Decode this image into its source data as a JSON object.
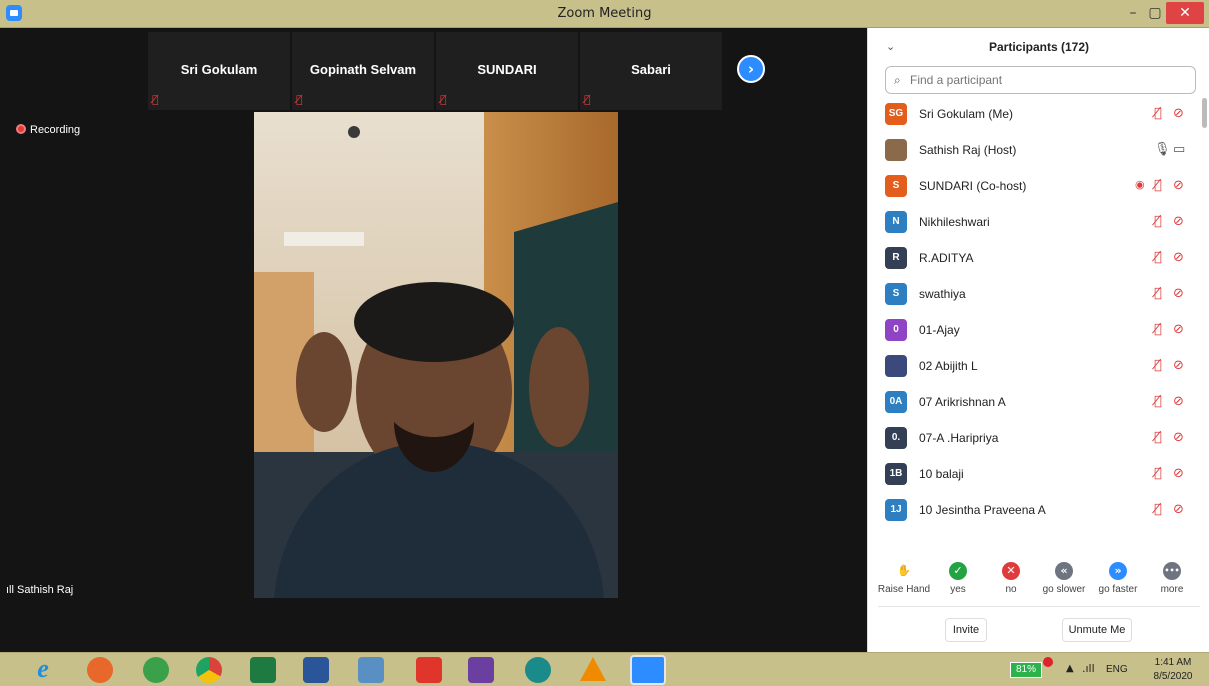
{
  "window": {
    "title": "Zoom Meeting",
    "min_label": "–",
    "max_label": "▢",
    "close_label": "✕"
  },
  "video_strip": {
    "thumbs": [
      {
        "name": "Sri Gokulam"
      },
      {
        "name": "Gopinath Selvam"
      },
      {
        "name": "SUNDARI"
      },
      {
        "name": "Sabari"
      }
    ],
    "next_icon": "›"
  },
  "recording": {
    "label": "Recording"
  },
  "active_speaker": {
    "label": "Sathish Raj"
  },
  "participants": {
    "title": "Participants (172)",
    "collapse_icon": "chevron-down-icon",
    "search_placeholder": "Find a participant",
    "list": [
      {
        "initials": "SG",
        "name": "Sri Gokulam (Me)",
        "color": "#e35d1c",
        "mic": "muted",
        "video": "off"
      },
      {
        "initials": "",
        "name": "Sathish Raj (Host)",
        "color": "#8a6a4a",
        "mic": "on",
        "video": "on"
      },
      {
        "initials": "S",
        "name": "SUNDARI (Co-host)",
        "color": "#e35d1c",
        "mic": "muted",
        "video": "off",
        "recording": true
      },
      {
        "initials": "N",
        "name": "Nikhileshwari",
        "color": "#2d7fc1",
        "mic": "muted",
        "video": "off"
      },
      {
        "initials": "R",
        "name": "R.ADITYA",
        "color": "#333f55",
        "mic": "muted",
        "video": "off"
      },
      {
        "initials": "S",
        "name": "swathiya",
        "color": "#2d7fc1",
        "mic": "muted",
        "video": "off"
      },
      {
        "initials": "0",
        "name": "01-Ajay",
        "color": "#8e44c4",
        "mic": "muted",
        "video": "off"
      },
      {
        "initials": "",
        "name": "02 Abijith L",
        "color": "#3b4a7a",
        "mic": "muted",
        "video": "off"
      },
      {
        "initials": "0A",
        "name": "07 Arikrishnan A",
        "color": "#2d7fc1",
        "mic": "muted",
        "video": "off"
      },
      {
        "initials": "0.",
        "name": "07-A .Haripriya",
        "color": "#333f55",
        "mic": "muted",
        "video": "off"
      },
      {
        "initials": "1B",
        "name": "10 balaji",
        "color": "#333f55",
        "mic": "muted",
        "video": "off"
      },
      {
        "initials": "1J",
        "name": "10 Jesintha Praveena A",
        "color": "#2d7fc1",
        "mic": "muted",
        "video": "off"
      }
    ]
  },
  "reactions": [
    {
      "label": "Raise Hand",
      "icon": "hand-icon",
      "color": "#2d8cff",
      "glyph": "✋"
    },
    {
      "label": "yes",
      "icon": "check-icon",
      "color": "#25a244",
      "glyph": "✓"
    },
    {
      "label": "no",
      "icon": "x-icon",
      "color": "#e03b3b",
      "glyph": "✕"
    },
    {
      "label": "go slower",
      "icon": "rewind-icon",
      "color": "#6e7580",
      "glyph": "«"
    },
    {
      "label": "go faster",
      "icon": "fast-forward-icon",
      "color": "#2d8cff",
      "glyph": "»"
    },
    {
      "label": "more",
      "icon": "more-icon",
      "color": "#6e7580",
      "glyph": "•••"
    }
  ],
  "footer": {
    "invite_label": "Invite",
    "unmute_label": "Unmute Me"
  },
  "taskbar": {
    "apps": [
      {
        "icon": "internet-explorer-icon",
        "color": "#1f8de0"
      },
      {
        "icon": "firefox-icon",
        "color": "#e8672a"
      },
      {
        "icon": "cloud-app-icon",
        "color": "#3aa04a"
      },
      {
        "icon": "chrome-icon",
        "color": "#d9433a"
      },
      {
        "icon": "excel-icon",
        "color": "#1f7a42"
      },
      {
        "icon": "word-icon",
        "color": "#2a5699"
      },
      {
        "icon": "notebook-icon",
        "color": "#5a8fc4"
      },
      {
        "icon": "anydesk-icon",
        "color": "#e0352b"
      },
      {
        "icon": "visual-studio-icon",
        "color": "#6a3fa0"
      },
      {
        "icon": "edge-icon",
        "color": "#1a8a8a"
      },
      {
        "icon": "vlc-icon",
        "color": "#f08a00"
      },
      {
        "icon": "zoom-icon",
        "color": "#2d8cff"
      }
    ],
    "battery_label": "81%",
    "battery_level": 0.81,
    "lang": "ENG",
    "time": "1:41 AM",
    "date": "8/5/2020"
  }
}
